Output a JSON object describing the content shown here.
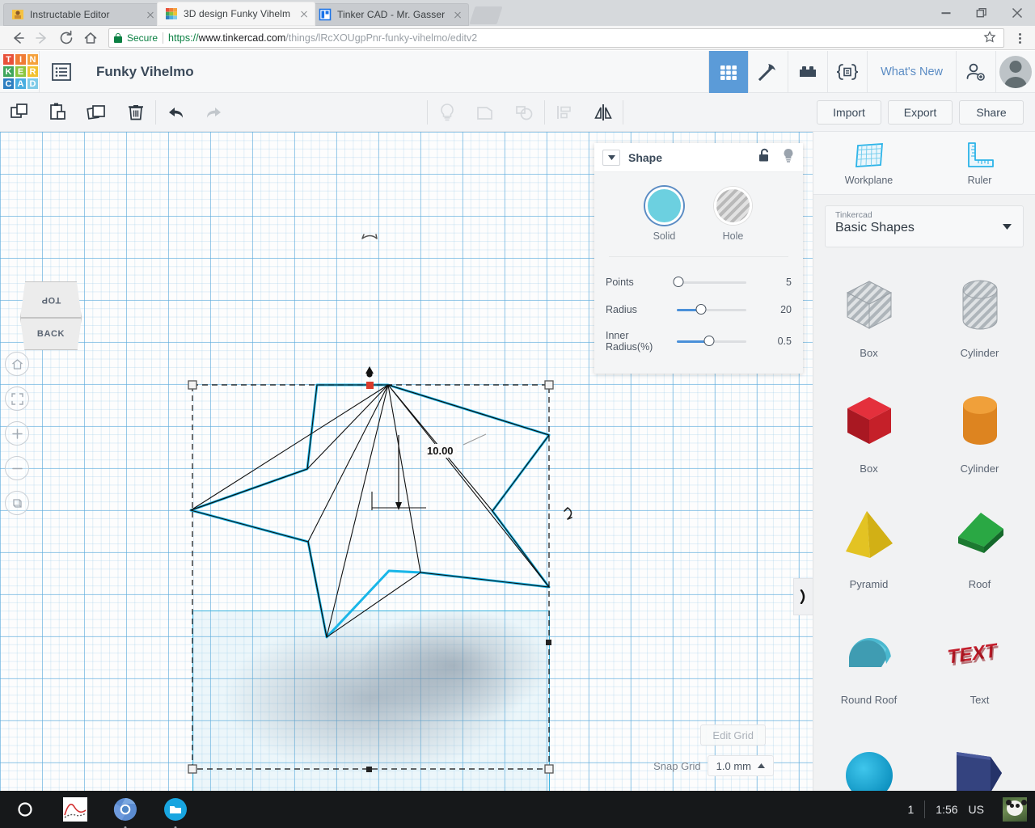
{
  "browser": {
    "tabs": [
      {
        "title": "Instructable Editor",
        "favicon": "instructables-icon",
        "active": false
      },
      {
        "title": "3D design Funky Vihelm",
        "favicon": "tinkercad-icon",
        "active": true
      },
      {
        "title": "Tinker CAD - Mr. Gasser",
        "favicon": "document-icon",
        "active": false
      }
    ],
    "new_tab_label": "New Tab",
    "window_controls": [
      "minimize",
      "restore",
      "close"
    ],
    "nav": {
      "back": "Back",
      "forward": "Forward",
      "reload": "Reload",
      "home": "Home"
    },
    "security_label": "Secure",
    "url": {
      "scheme": "https://",
      "host": "www.tinkercad.com",
      "path": "/things/lRcXOUgpPnr-funky-vihelmo/editv2",
      "full": "https://www.tinkercad.com/things/lRcXOUgpPnr-funky-vihelmo/editv2"
    },
    "bookmark_label": "Bookmark this page",
    "menu_label": "Customize and control Google Chrome"
  },
  "app_header": {
    "logo_tiles": [
      {
        "letter": "T",
        "color": "#e8513a"
      },
      {
        "letter": "I",
        "color": "#f07c35"
      },
      {
        "letter": "N",
        "color": "#f5a13c"
      },
      {
        "letter": "K",
        "color": "#3fa65c"
      },
      {
        "letter": "E",
        "color": "#8cc63f"
      },
      {
        "letter": "R",
        "color": "#f2c230"
      },
      {
        "letter": "C",
        "color": "#2e7fc1"
      },
      {
        "letter": "A",
        "color": "#4aaee0"
      },
      {
        "letter": "D",
        "color": "#7fcbe8"
      }
    ],
    "menu_icon": "list-menu-icon",
    "project_title": "Funky Vihelmo",
    "nav_icons": [
      {
        "name": "blocks-grid-icon",
        "label": "3D Design",
        "active": true
      },
      {
        "name": "pickaxe-icon",
        "label": "Minecraft",
        "active": false
      },
      {
        "name": "lego-brick-icon",
        "label": "Bricks",
        "active": false
      },
      {
        "name": "codeblocks-icon",
        "label": "Codeblocks",
        "active": false
      }
    ],
    "whats_new": "What's New",
    "add_user_icon": "add-person-icon",
    "avatar": "user-avatar"
  },
  "toolbar": {
    "left_icons": [
      {
        "name": "copy-icon",
        "label": "Copy"
      },
      {
        "name": "paste-icon",
        "label": "Paste"
      },
      {
        "name": "duplicate-icon",
        "label": "Duplicate"
      },
      {
        "name": "delete-icon",
        "label": "Delete"
      }
    ],
    "history_icons": [
      {
        "name": "undo-icon",
        "label": "Undo",
        "enabled": true
      },
      {
        "name": "redo-icon",
        "label": "Redo",
        "enabled": false
      }
    ],
    "edit_icons": [
      {
        "name": "lightbulb-icon",
        "label": "Hints",
        "enabled": false
      },
      {
        "name": "group-icon",
        "label": "Group",
        "enabled": false
      },
      {
        "name": "ungroup-icon",
        "label": "Ungroup",
        "enabled": false
      },
      {
        "name": "align-icon",
        "label": "Align",
        "enabled": false
      },
      {
        "name": "mirror-icon",
        "label": "Mirror",
        "enabled": true
      }
    ],
    "buttons": [
      {
        "name": "import-button",
        "label": "Import"
      },
      {
        "name": "export-button",
        "label": "Export"
      },
      {
        "name": "share-button",
        "label": "Share"
      }
    ]
  },
  "canvas": {
    "viewcube": {
      "top_face": "TOP",
      "front_face": "BACK"
    },
    "view_tools": [
      {
        "name": "home-view-icon",
        "label": "Home view"
      },
      {
        "name": "fit-view-icon",
        "label": "Fit all in view"
      },
      {
        "name": "zoom-in-icon",
        "label": "Zoom in"
      },
      {
        "name": "zoom-out-icon",
        "label": "Zoom out"
      },
      {
        "name": "perspective-icon",
        "label": "Switch to orthographic view"
      }
    ],
    "dimension_label": "10.00",
    "edit_grid_label": "Edit Grid",
    "snap_grid_label": "Snap Grid",
    "snap_grid_value": "1.0 mm",
    "panel_handle_icon": "chevron-right-icon"
  },
  "shape_panel": {
    "title": "Shape",
    "collapse_icon": "caret-down-icon",
    "lock_icon": "unlock-icon",
    "hint_icon": "lightbulb-icon",
    "modes": [
      {
        "name": "solid",
        "label": "Solid",
        "selected": true,
        "color": "#6cd0e0"
      },
      {
        "name": "hole",
        "label": "Hole",
        "selected": false
      }
    ],
    "sliders": [
      {
        "name": "points",
        "label": "Points",
        "value": "5",
        "fill_pct": 0
      },
      {
        "name": "radius",
        "label": "Radius",
        "value": "20",
        "fill_pct": 34
      },
      {
        "name": "inner-radius",
        "label": "Inner Radius(%)",
        "value": "0.5",
        "fill_pct": 46
      }
    ]
  },
  "sidebar": {
    "tools": [
      {
        "name": "workplane-tool",
        "label": "Workplane"
      },
      {
        "name": "ruler-tool",
        "label": "Ruler"
      }
    ],
    "library": {
      "group": "Tinkercad",
      "name": "Basic Shapes",
      "caret": "caret-down-icon"
    },
    "shapes": [
      {
        "name": "box-hole",
        "label": "Box",
        "kind": "box",
        "style": "hole"
      },
      {
        "name": "cylinder-hole",
        "label": "Cylinder",
        "kind": "cylinder",
        "style": "hole"
      },
      {
        "name": "box-solid",
        "label": "Box",
        "kind": "box",
        "color": "#cf2230"
      },
      {
        "name": "cylinder-solid",
        "label": "Cylinder",
        "kind": "cylinder",
        "color": "#e8962a"
      },
      {
        "name": "pyramid",
        "label": "Pyramid",
        "kind": "pyramid",
        "color": "#e8c41d"
      },
      {
        "name": "roof",
        "label": "Roof",
        "kind": "roof",
        "color": "#2aa844"
      },
      {
        "name": "round-roof",
        "label": "Round Roof",
        "kind": "roundroof",
        "color": "#4bb8cf"
      },
      {
        "name": "text",
        "label": "Text",
        "kind": "text",
        "color": "#c21d2b"
      },
      {
        "name": "sphere",
        "label": "",
        "kind": "sphere",
        "color": "#15a8d8"
      },
      {
        "name": "wedge",
        "label": "",
        "kind": "wedge",
        "color": "#2f3f7f"
      }
    ]
  },
  "shelf": {
    "apps": [
      {
        "name": "launcher-icon",
        "label": "Launcher"
      },
      {
        "name": "graph-app-icon",
        "label": "Graph"
      },
      {
        "name": "chrome-icon",
        "label": "Chrome",
        "running": true
      },
      {
        "name": "files-icon",
        "label": "Files",
        "running": true
      }
    ],
    "status": {
      "desk_number": "1",
      "time": "1:56",
      "keyboard": "US",
      "avatar": "panda-avatar"
    }
  }
}
